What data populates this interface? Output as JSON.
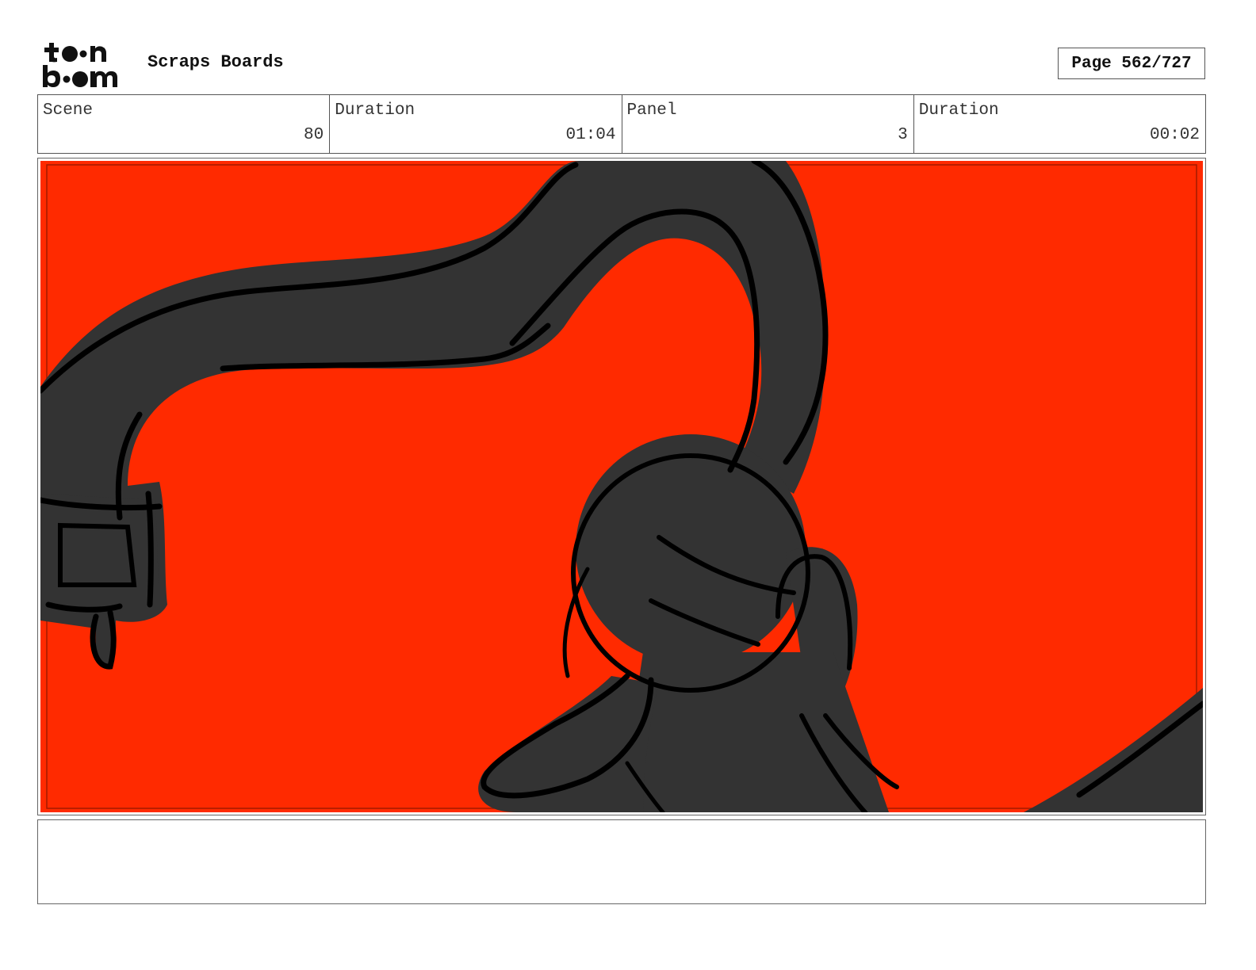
{
  "header": {
    "logo_top": "toon",
    "logo_bottom": "boom",
    "project_title": "Scraps Boards",
    "page_label": "Page",
    "page_value": "562/727"
  },
  "info": {
    "scene_label": "Scene",
    "scene_value": "80",
    "scene_duration_label": "Duration",
    "scene_duration_value": "01:04",
    "panel_label": "Panel",
    "panel_value": "3",
    "panel_duration_label": "Duration",
    "panel_duration_value": "00:02"
  },
  "panel": {
    "background_color": "#ff2a00",
    "fill_color": "#333333",
    "line_color": "#000000"
  },
  "notes": {
    "text": ""
  }
}
